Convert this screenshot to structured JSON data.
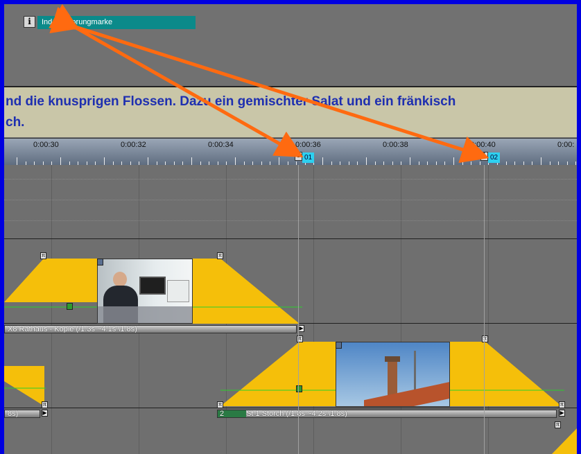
{
  "top_track": {
    "info_icon": "info-icon",
    "info_glyph": "i",
    "marker_label": "Index / Sprungmarke"
  },
  "subtitle": {
    "line1": "nd die knusprigen Flossen. Dazu ein gemischter Salat und ein fränkisch",
    "line2": "ch."
  },
  "ruler": {
    "labels": [
      "0:00:30",
      "0:00:32",
      "0:00:34",
      "0:00:36",
      "0:00:38",
      "0:00:40",
      "0:00:"
    ],
    "markers": [
      {
        "id": "01",
        "time": "0:00:36"
      },
      {
        "id": "02",
        "time": "0:00:40"
      }
    ]
  },
  "clips": {
    "rathaus_label": "X8 Rathaus - Kopie (/1.3s ~4.1s \\1.8s)",
    "storch_label": "St 1 Storch (/1.8s ~4.2s \\1.8s)",
    "storch_index": "2",
    "partial_label": "8s)"
  },
  "colors": {
    "frame": "#0000e0",
    "transition": "#f5bf0a",
    "marker_flag": "#2dd0f0",
    "annotation_arrow": "#ff6a10",
    "subtitle_text": "#1e2fb0"
  }
}
